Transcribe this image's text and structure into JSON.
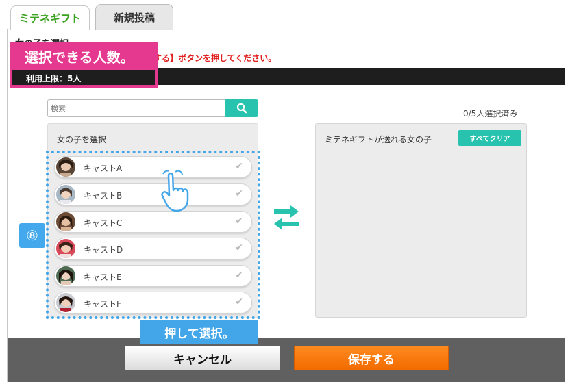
{
  "tabs": [
    {
      "label": "ミテネギフト",
      "active": true
    },
    {
      "label": "新規投稿",
      "active": false
    }
  ],
  "section_title": "女の子を選択",
  "notice": "する】ボタンを押してください。",
  "callout": {
    "title": "選択できる人数。",
    "limit": "利用上限：5人"
  },
  "search": {
    "placeholder": "検索"
  },
  "selected_count": "0/5人選択済み",
  "left_panel": {
    "label": "女の子を選択",
    "casts": [
      {
        "name": "キャストA"
      },
      {
        "name": "キャストB"
      },
      {
        "name": "キャストC"
      },
      {
        "name": "キャストD"
      },
      {
        "name": "キャストE"
      },
      {
        "name": "キャストF"
      }
    ]
  },
  "right_panel": {
    "label": "ミテネギフトが送れる女の子",
    "clear_label": "すべてクリア"
  },
  "step_badge": "⑧",
  "push_label": "押して選択。",
  "footer": {
    "cancel_label": "キャンセル",
    "save_label": "保存する"
  },
  "colors": {
    "accent_teal": "#27c3ae",
    "callout_pink": "#e5388f",
    "annotation_blue": "#43a6e9",
    "save_orange": "#f57200",
    "notice_red": "#e02020"
  }
}
